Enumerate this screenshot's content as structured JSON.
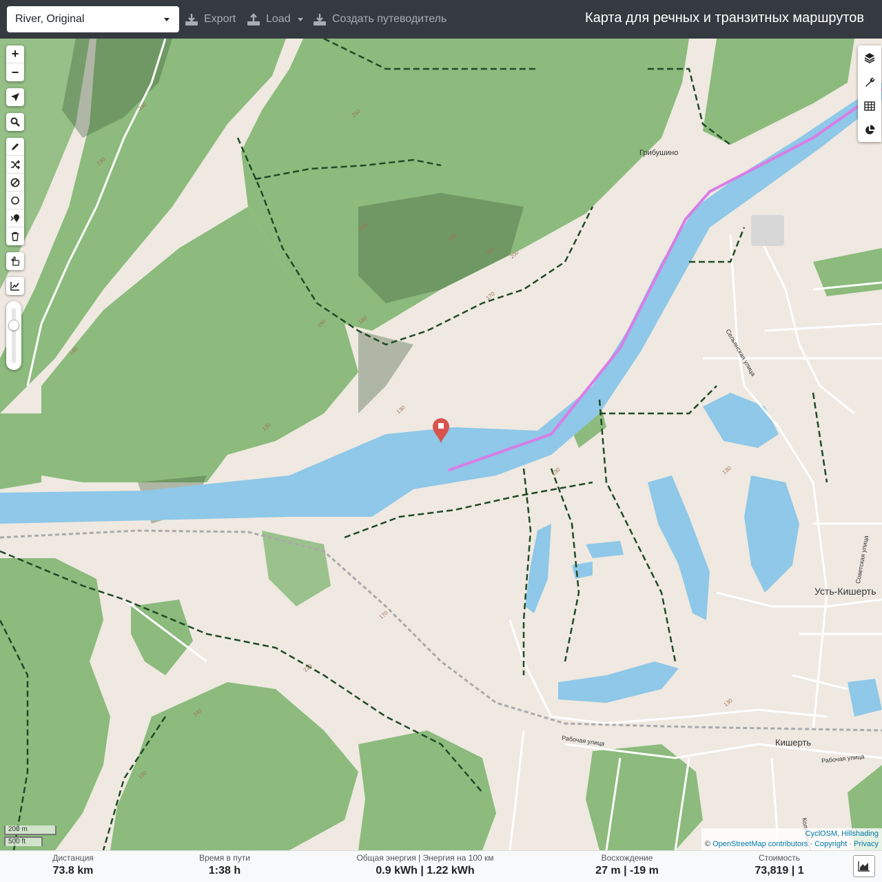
{
  "topbar": {
    "profile": "River, Original",
    "export_label": "Export",
    "load_label": "Load",
    "guide_label": "Создать путеводитель",
    "title": "Карта для речных и транзитных маршрутов"
  },
  "controls": {
    "zoom_in": "+",
    "zoom_out": "−"
  },
  "map_labels": {
    "village_gribushino": "Грибушино",
    "village_ust_kishert": "Усть-Кишерть",
    "town_kishert": "Кишерть",
    "street_selyanskaya": "Сельянская улица",
    "street_sovetskaya": "Советская улица",
    "street_rabochaya_1": "Рабочая улица",
    "street_rabochaya_2": "Рабочая улица",
    "street_kolkhoznaya": "Колхозная улица",
    "contours": [
      "240",
      "250",
      "230",
      "220",
      "190",
      "180",
      "200",
      "170",
      "160",
      "150",
      "140",
      "130",
      "130",
      "130",
      "130",
      "170",
      "220",
      "240",
      "130",
      "190"
    ]
  },
  "scale": {
    "metric": "200 m",
    "imperial": "500 ft"
  },
  "attribution": {
    "line1": "CyclOSM, Hillshading",
    "prefix": "©",
    "osm": "OpenStreetMap contributors",
    "sep": "·",
    "copyright": "Copyright",
    "privacy": "Privacy"
  },
  "stats": {
    "distance_label": "Дистанция",
    "distance_value": "73.8 km",
    "time_label": "Время в пути",
    "time_value": "1:38 h",
    "energy_label": "Общая энергия | Энергия на 100 км",
    "energy_value": "0.9 kWh | 1.22 kWh",
    "ascent_label": "Восхождение",
    "ascent_value": "27 m | -19 m",
    "cost_label": "Стоимость",
    "cost_value": "73,819 | 1"
  },
  "colors": {
    "topbar": "#343a40",
    "water": "#8fc8e8",
    "forest": "#8cbb7d",
    "route": "#d97de6",
    "marker": "#d9534f"
  },
  "icons": [
    "upload-icon",
    "download-icon",
    "locate-icon",
    "search-icon",
    "pencil-icon",
    "shuffle-icon",
    "ban-icon",
    "circle-icon",
    "pin-icon",
    "trash-icon",
    "hand-icon",
    "chart-icon",
    "layers-icon",
    "wrench-icon",
    "table-icon",
    "pie-icon",
    "marker-icon"
  ]
}
